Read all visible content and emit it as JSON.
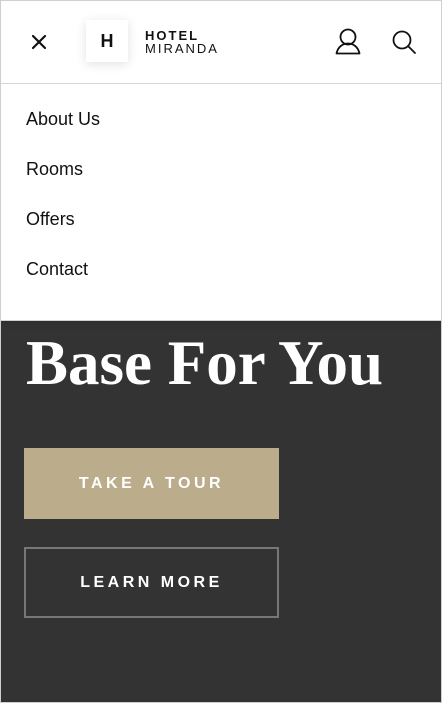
{
  "header": {
    "logo_letter": "H",
    "logo_line1": "HOTEL",
    "logo_line2": "MIRANDA",
    "icons": [
      "close-icon",
      "user-icon",
      "search-icon"
    ]
  },
  "menu": {
    "items": [
      {
        "label": "About Us"
      },
      {
        "label": "Rooms"
      },
      {
        "label": "Offers"
      },
      {
        "label": "Contact"
      }
    ]
  },
  "hero": {
    "title": "Base For You",
    "tour_button": "TAKE A TOUR",
    "learn_button": "LEARN MORE"
  },
  "colors": {
    "hero_background": "#333333",
    "accent_gold": "#bbad8c",
    "text_dark": "#111111",
    "white": "#ffffff"
  }
}
